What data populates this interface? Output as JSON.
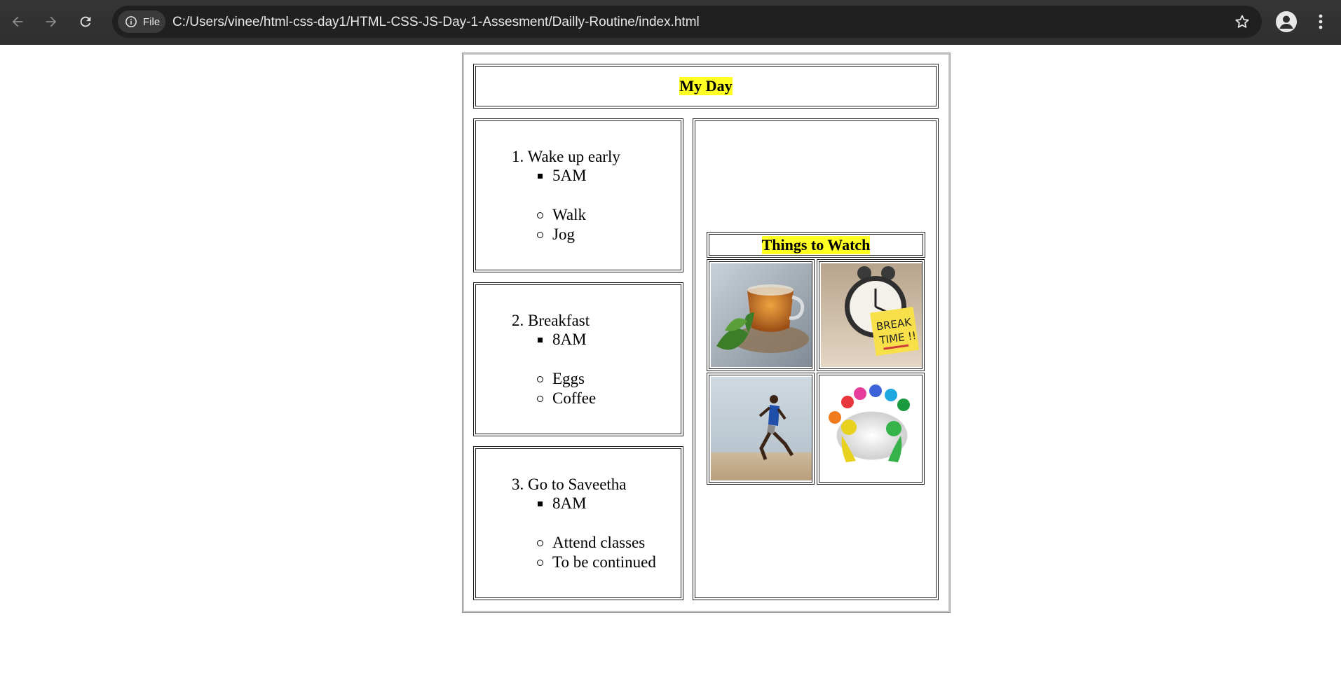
{
  "browser": {
    "chip_label": "File",
    "url": "C:/Users/vinee/html-css-day1/HTML-CSS-JS-Day-1-Assesment/Dailly-Routine/index.html",
    "icons": {
      "back": "arrow-left-icon",
      "forward": "arrow-right-icon",
      "reload": "reload-icon",
      "info": "info-icon",
      "bookmark": "star-icon",
      "profile": "profile-icon",
      "menu": "kebab-menu-icon"
    }
  },
  "page": {
    "title": "My Day",
    "routine": [
      {
        "item": "1. Wake up early",
        "time": "5AM",
        "activities": [
          "Walk",
          "Jog"
        ]
      },
      {
        "item": "2. Breakfast",
        "time": "8AM",
        "activities": [
          "Eggs",
          "Coffee"
        ]
      },
      {
        "item": "3. Go to Saveetha",
        "time": "8AM",
        "activities": [
          "Attend classes",
          "To be continued"
        ]
      }
    ],
    "watch": {
      "title": "Things to Watch",
      "images": [
        "tea-image",
        "break-time-clock-image",
        "runner-image",
        "team-meeting-image"
      ],
      "break_sign": [
        "BREAK",
        "TIME !!"
      ]
    },
    "colors": {
      "highlight": "#ffff24",
      "toolbar": "#353535",
      "omnibox": "#202020"
    }
  }
}
